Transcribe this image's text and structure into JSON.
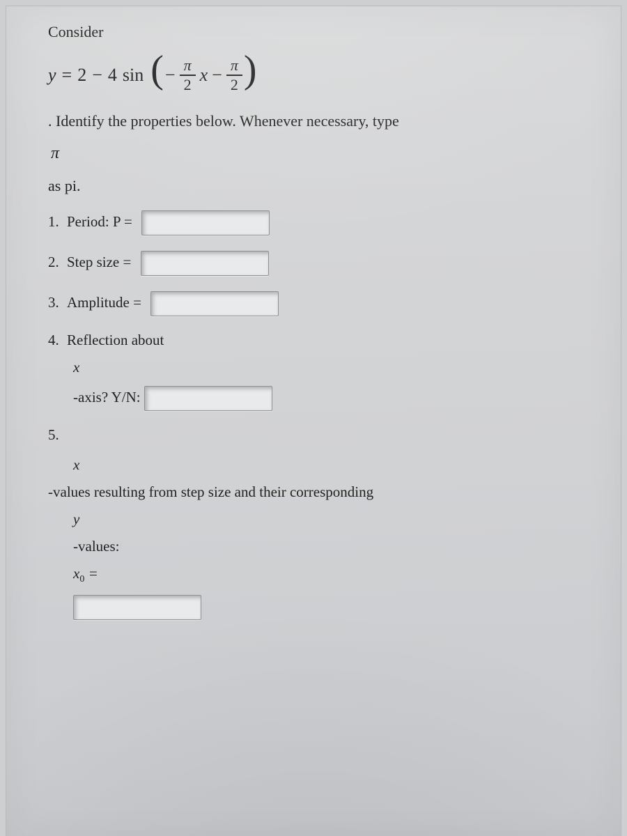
{
  "heading": "Consider",
  "equation": {
    "y": "y",
    "eq_sign": "=",
    "a": "2",
    "minus": "−",
    "b": "4",
    "fn": "sin",
    "neg": "−",
    "pi": "π",
    "two": "2",
    "xvar": "x",
    "minus2": "−"
  },
  "leadin": ".  Identify the properties below.  Whenever necessary, type",
  "pi_line": "π",
  "as_pi": "as pi.",
  "items": {
    "period_label": "Period: P =",
    "step_label": "Step size =",
    "amp_label": "Amplitude =",
    "reflect_label": "Reflection about",
    "reflect_var": "x",
    "reflect_q": "-axis? Y/N:",
    "five_intro_var": "x",
    "five_intro_rest": "-values resulting from step size and their corresponding",
    "y_var": "y",
    "values_label": "-values:",
    "x0_label_x": "x",
    "x0_label_sub": "0",
    "x0_eq": " ="
  }
}
